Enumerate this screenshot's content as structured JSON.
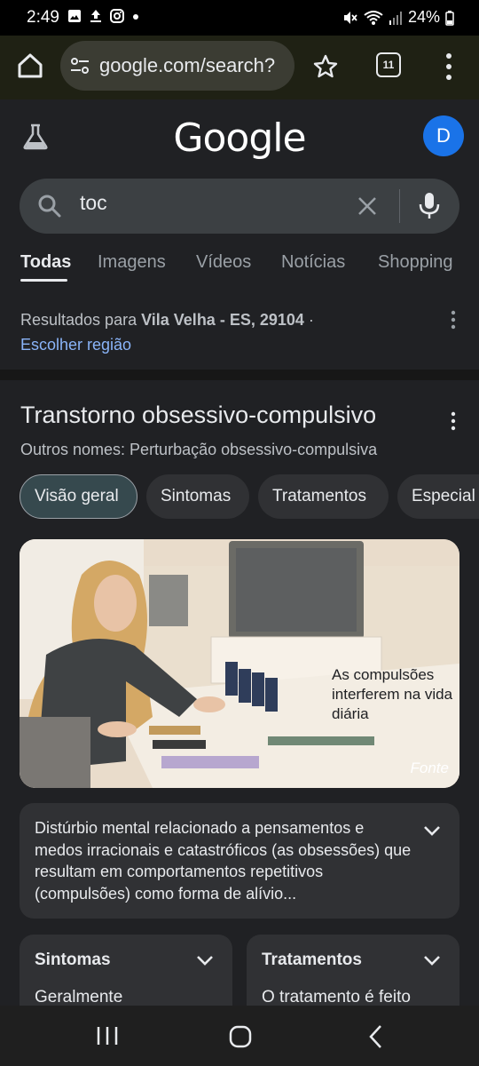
{
  "status_bar": {
    "time": "2:49",
    "battery": "24%",
    "left_icons": [
      "image-icon",
      "upload-icon",
      "instagram-icon",
      "dot-icon"
    ],
    "right_icons": [
      "mute-icon",
      "wifi-icon",
      "signal-icon",
      "battery-icon"
    ]
  },
  "browser": {
    "url": "google.com/search?",
    "tab_count": "11"
  },
  "header": {
    "logo_text": "Google",
    "avatar_letter": "D"
  },
  "search": {
    "query": "toc"
  },
  "tabs": [
    {
      "label": "Todas",
      "active": true
    },
    {
      "label": "Imagens"
    },
    {
      "label": "Vídeos"
    },
    {
      "label": "Notícias"
    },
    {
      "label": "Shopping"
    }
  ],
  "region": {
    "prefix": "Resultados para ",
    "location": "Vila Velha - ES, 29104",
    "suffix": " ·",
    "link": "Escolher região"
  },
  "knowledge_panel": {
    "title": "Transtorno obsessivo-compulsivo",
    "subtitle": "Outros nomes: Perturbação obsessivo-compulsiva",
    "chips": [
      "Visão geral",
      "Sintomas",
      "Tratamentos",
      "Especial"
    ],
    "image_caption": "As compulsões interferem na vida diária",
    "image_source": "Fonte",
    "description": "Distúrbio mental relacionado a pensamentos e medos irracionais e catastróficos (as obsessões) que resultam em comportamentos repetitivos (compulsões) como forma de alívio...",
    "cards": [
      {
        "title": "Sintomas",
        "text": "Geralmente"
      },
      {
        "title": "Tratamentos",
        "text": "O tratamento é feito"
      }
    ]
  },
  "colors": {
    "accent_link": "#8ab4f8",
    "avatar_bg": "#1a73e8",
    "chip_active_bg": "#36494e"
  }
}
